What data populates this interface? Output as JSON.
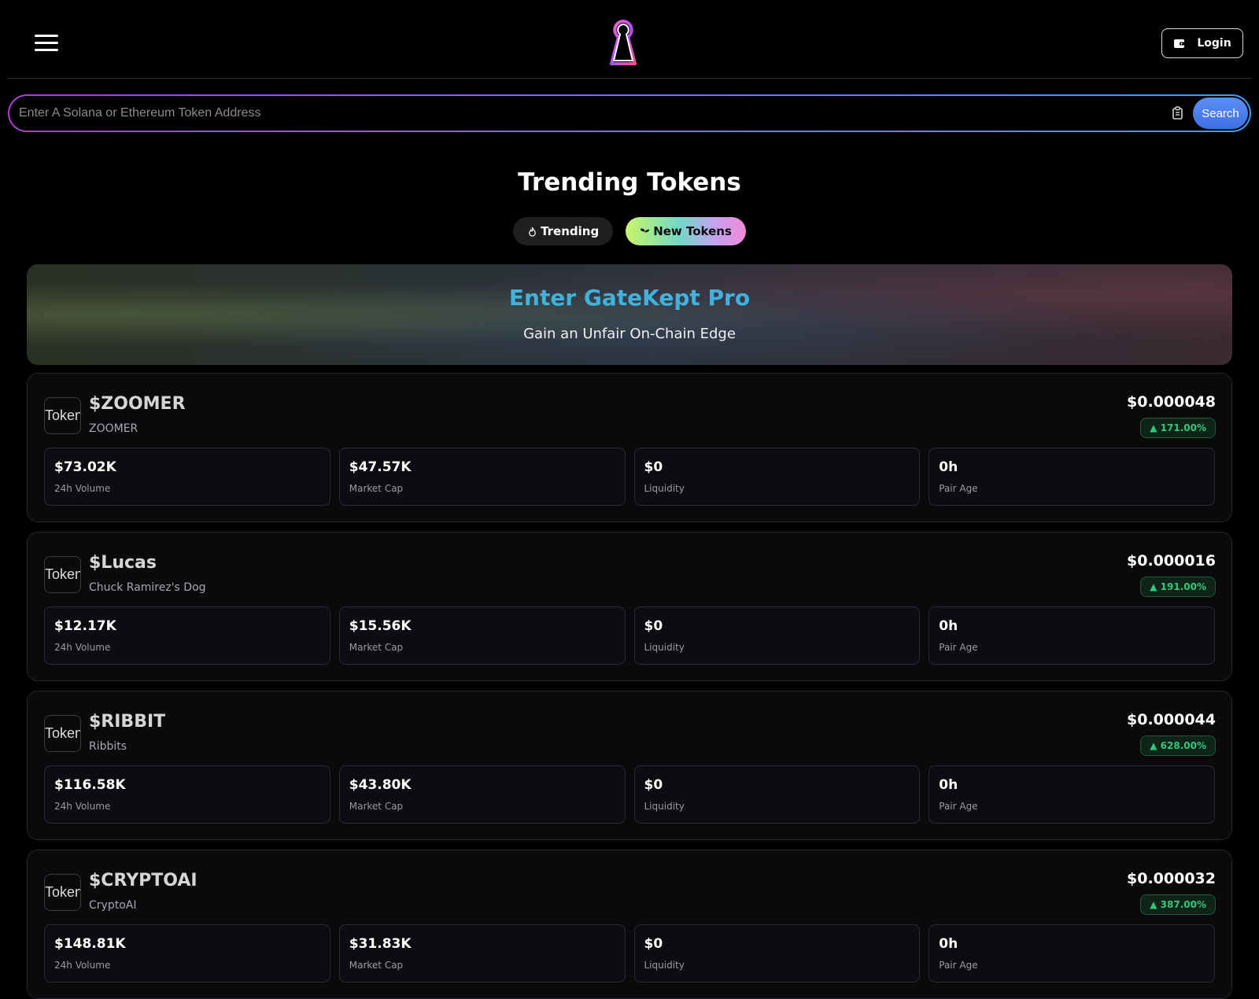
{
  "header": {
    "login_label": "Login",
    "icons": {
      "menu": "hamburger-icon",
      "logo": "keyhole-logo",
      "login": "wallet-icon"
    }
  },
  "search": {
    "placeholder": "Enter A Solana or Ethereum Token Address",
    "value": "",
    "button_label": "Search",
    "paste_icon": "clipboard-icon"
  },
  "page_title": "Trending Tokens",
  "tabs": [
    {
      "label": "Trending",
      "icon": "flame-icon",
      "active": false
    },
    {
      "label": "New Tokens",
      "icon": "sprout-icon",
      "active": true
    }
  ],
  "promo": {
    "title": "Enter GateKept Pro",
    "subtitle": "Gain an Unfair On-Chain Edge"
  },
  "tokens": [
    {
      "logo_alt": "Token",
      "symbol": "$ZOOMER",
      "name": "ZOOMER",
      "price": "$0.000048",
      "change": "▲ 171.00%",
      "stats": [
        {
          "value": "$73.02K",
          "label": "24h Volume"
        },
        {
          "value": "$47.57K",
          "label": "Market Cap"
        },
        {
          "value": "$0",
          "label": "Liquidity"
        },
        {
          "value": "0h",
          "label": "Pair Age"
        }
      ]
    },
    {
      "logo_alt": "Token",
      "symbol": "$Lucas",
      "name": "Chuck Ramirez's Dog",
      "price": "$0.000016",
      "change": "▲ 191.00%",
      "stats": [
        {
          "value": "$12.17K",
          "label": "24h Volume"
        },
        {
          "value": "$15.56K",
          "label": "Market Cap"
        },
        {
          "value": "$0",
          "label": "Liquidity"
        },
        {
          "value": "0h",
          "label": "Pair Age"
        }
      ]
    },
    {
      "logo_alt": "Token",
      "symbol": "$RIBBIT",
      "name": "Ribbits",
      "price": "$0.000044",
      "change": "▲ 628.00%",
      "stats": [
        {
          "value": "$116.58K",
          "label": "24h Volume"
        },
        {
          "value": "$43.80K",
          "label": "Market Cap"
        },
        {
          "value": "$0",
          "label": "Liquidity"
        },
        {
          "value": "0h",
          "label": "Pair Age"
        }
      ]
    },
    {
      "logo_alt": "Token",
      "symbol": "$CRYPTOAI",
      "name": "CryptoAI",
      "price": "$0.000032",
      "change": "▲ 387.00%",
      "stats": [
        {
          "value": "$148.81K",
          "label": "24h Volume"
        },
        {
          "value": "$31.83K",
          "label": "Market Cap"
        },
        {
          "value": "$0",
          "label": "Liquidity"
        },
        {
          "value": "0h",
          "label": "Pair Age"
        }
      ]
    }
  ],
  "colors": {
    "background": "#000000",
    "card_background": "#0a0a0d",
    "accent_blue": "#3fb3de",
    "search_button": "#4a7ff0",
    "positive_change": "#34c77b"
  }
}
